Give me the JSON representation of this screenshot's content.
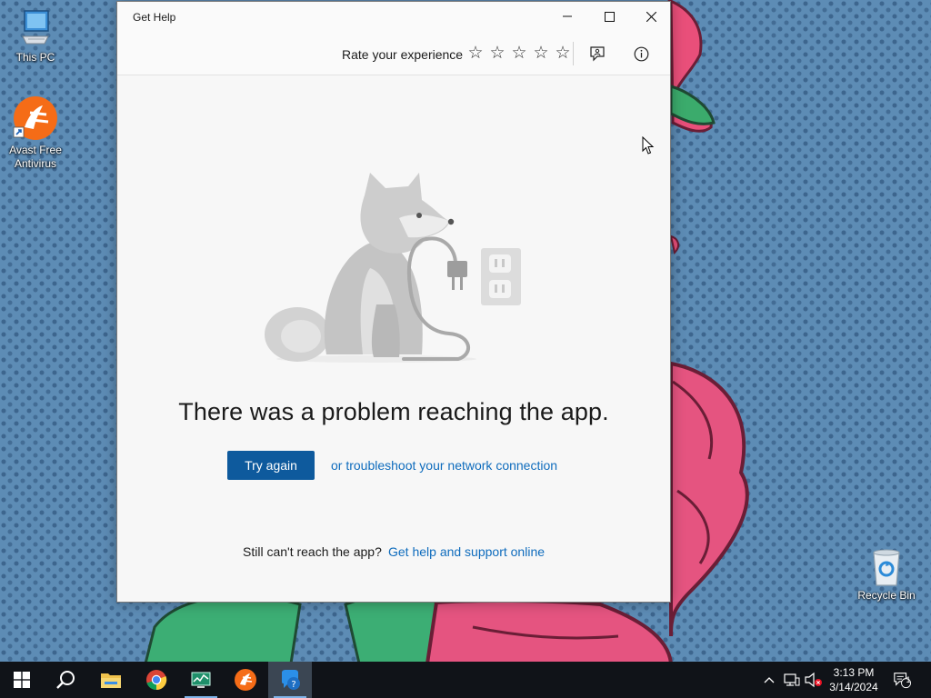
{
  "desktop": {
    "icons": [
      {
        "label": "This PC"
      },
      {
        "label": "Avast Free Antivirus"
      },
      {
        "label": "Recycle Bin"
      }
    ]
  },
  "window": {
    "title": "Get Help",
    "toolbar": {
      "rate_label": "Rate your experience",
      "stars": [
        "☆",
        "☆",
        "☆",
        "☆",
        "☆"
      ],
      "feedback_icon": "feedback-icon",
      "info_icon": "info-icon"
    },
    "error": {
      "message": "There was a problem reaching the app.",
      "try_again": "Try again",
      "troubleshoot_link": "or troubleshoot your network connection",
      "still_text": "Still can't reach the app?",
      "support_link": "Get help and support online"
    },
    "colors": {
      "primary_button": "#0e5a9d",
      "link": "#0f6cbd"
    }
  },
  "taskbar": {
    "items": [
      "start-icon",
      "search-icon",
      "file-explorer-icon",
      "chrome-icon",
      "task-manager-icon",
      "avast-icon",
      "get-help-icon"
    ],
    "active_item": "get-help-icon",
    "clock": {
      "time": "3:13 PM",
      "date": "3/14/2024"
    },
    "notification_count": "1"
  }
}
